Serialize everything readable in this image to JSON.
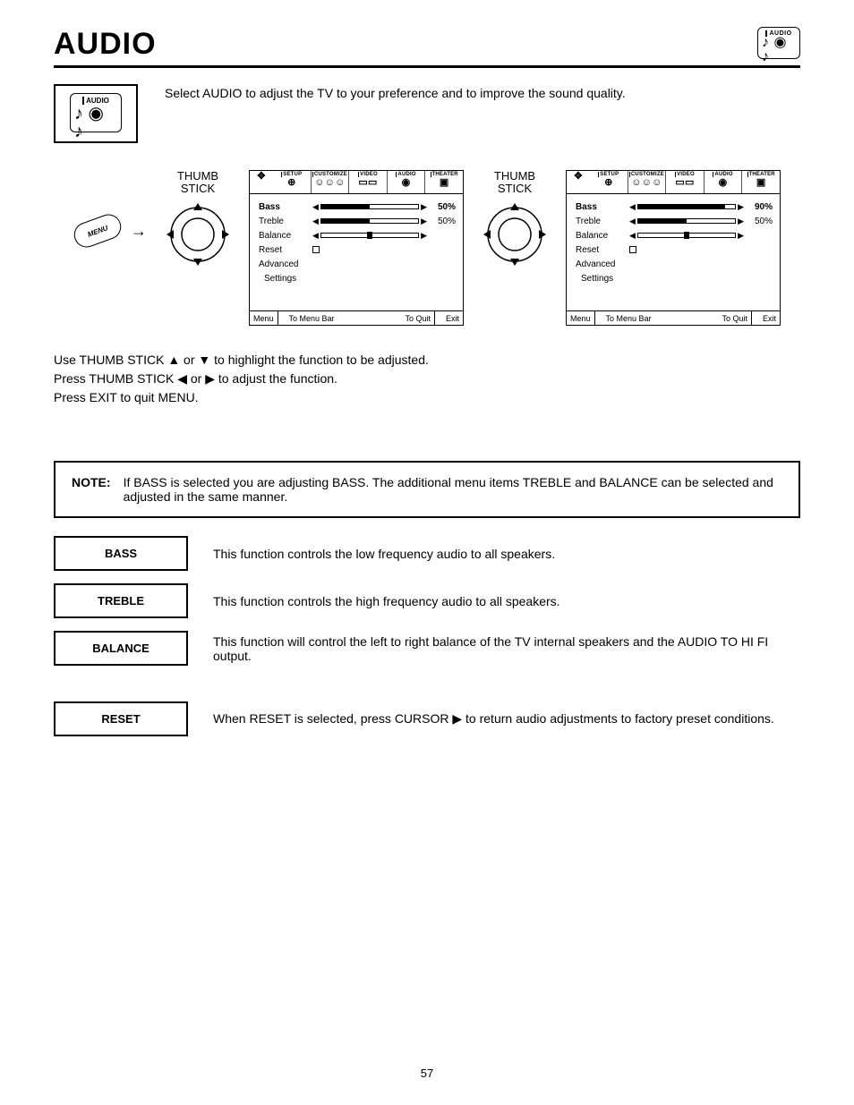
{
  "header": {
    "title": "AUDIO",
    "page_num": "57"
  },
  "corner_icon": {
    "label": "AUDIO",
    "glyph": "♪ ◉ ♪"
  },
  "intro": {
    "icon_label": "AUDIO",
    "icon_glyph": "♪ ◉ ♪",
    "text": "Select AUDIO to adjust the TV to your preference and to improve the sound quality."
  },
  "diagram": {
    "thumb_label": "THUMB\nSTICK",
    "menu_button": "MENU",
    "tabs": [
      "SETUP",
      "CUSTOMIZE",
      "VIDEO",
      "AUDIO",
      "THEATER"
    ],
    "tab_icons": [
      "⊕",
      "☺☺☺",
      "▭▭",
      "◉",
      "▣"
    ],
    "screen_a": {
      "rows": {
        "bass": {
          "label": "Bass",
          "pct": "50%",
          "fill": 50,
          "sel": true
        },
        "treble": {
          "label": "Treble",
          "pct": "50%",
          "fill": 50,
          "sel": false
        },
        "balance": {
          "label": "Balance"
        },
        "reset": {
          "label": "Reset"
        },
        "advanced1": "Advanced",
        "advanced2": "Settings"
      }
    },
    "screen_b": {
      "rows": {
        "bass": {
          "label": "Bass",
          "pct": "90%",
          "fill": 90,
          "sel": true
        },
        "treble": {
          "label": "Treble",
          "pct": "50%",
          "fill": 50,
          "sel": false
        },
        "balance": {
          "label": "Balance"
        },
        "reset": {
          "label": "Reset"
        },
        "advanced1": "Advanced",
        "advanced2": "Settings"
      }
    },
    "footer": {
      "menu": "Menu",
      "bar": "To Menu Bar",
      "quit": "To Quit",
      "exit": "Exit"
    }
  },
  "instructions": {
    "l1": "Use THUMB STICK ▲ or ▼ to highlight the function to be adjusted.",
    "l2": "Press THUMB STICK ◀ or ▶ to adjust the function.",
    "l3": "Press EXIT to quit MENU."
  },
  "note": {
    "label": "NOTE:",
    "text": "If BASS is selected you are adjusting BASS.  The additional menu items TREBLE and BALANCE can be selected and adjusted in the same manner."
  },
  "funcs": {
    "bass": {
      "tag": "BASS",
      "desc": "This function controls the low frequency audio to all speakers."
    },
    "treble": {
      "tag": "TREBLE",
      "desc": "This function controls the high frequency audio to all speakers."
    },
    "balance": {
      "tag": "BALANCE",
      "desc": "This function will control the left to right balance of the TV internal speakers and the AUDIO TO HI FI output."
    },
    "reset": {
      "tag": "RESET",
      "desc": "When RESET is selected, press CURSOR ▶ to return audio adjustments to factory preset conditions."
    }
  }
}
